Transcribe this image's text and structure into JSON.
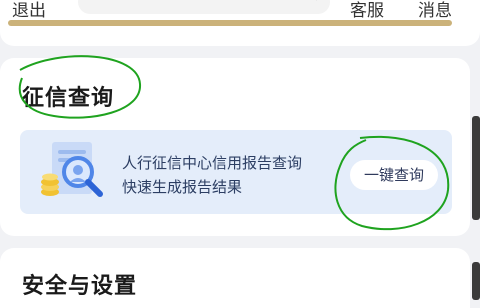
{
  "header": {
    "back_label": "退出",
    "service_label": "客服",
    "message_label": "消息"
  },
  "credit_card": {
    "title": "征信查询",
    "banner_line1": "人行征信中心信用报告查询",
    "banner_line2": "快速生成报告结果",
    "query_button": "一键查询"
  },
  "settings": {
    "title": "安全与设置"
  },
  "colors": {
    "accent_gold": "#cbb27a",
    "banner_bg": "#e4edfa",
    "annotation_green": "#1fa31f"
  }
}
